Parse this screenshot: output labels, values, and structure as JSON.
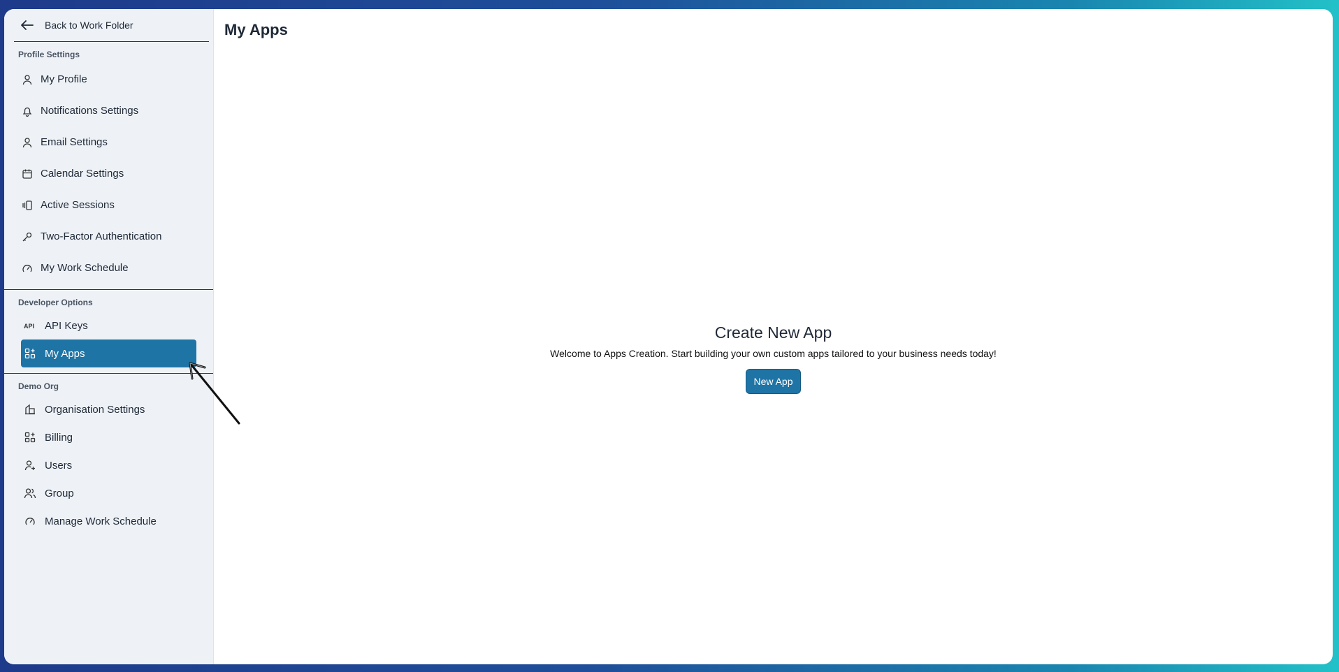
{
  "sidebar": {
    "back_label": "Back to Work Folder",
    "profile_section": "Profile Settings",
    "profile_items": [
      {
        "label": "My Profile",
        "icon": "user-icon"
      },
      {
        "label": "Notifications Settings",
        "icon": "bell-icon"
      },
      {
        "label": "Email Settings",
        "icon": "user-icon"
      },
      {
        "label": "Calendar Settings",
        "icon": "calendar-icon"
      },
      {
        "label": "Active Sessions",
        "icon": "sessions-icon"
      },
      {
        "label": "Two-Factor Authentication",
        "icon": "key-icon"
      },
      {
        "label": "My Work Schedule",
        "icon": "gauge-icon"
      }
    ],
    "developer_section": "Developer Options",
    "developer_items": [
      {
        "label": "API Keys",
        "icon": "api-icon"
      },
      {
        "label": "My Apps",
        "icon": "apps-grid-icon",
        "active": true
      }
    ],
    "org_section": "Demo Org",
    "org_items": [
      {
        "label": "Organisation Settings",
        "icon": "building-icon"
      },
      {
        "label": "Billing",
        "icon": "apps-grid-icon"
      },
      {
        "label": "Users",
        "icon": "user-plus-icon"
      },
      {
        "label": "Group",
        "icon": "users-icon"
      },
      {
        "label": "Manage Work Schedule",
        "icon": "gauge-icon"
      }
    ]
  },
  "main": {
    "title": "My Apps",
    "empty_title": "Create New App",
    "empty_text": "Welcome to Apps Creation. Start building your own custom apps tailored to your business needs today!",
    "new_app_label": "New App"
  },
  "colors": {
    "accent": "#1f74a6",
    "sidebar_bg": "#eef2f7"
  }
}
